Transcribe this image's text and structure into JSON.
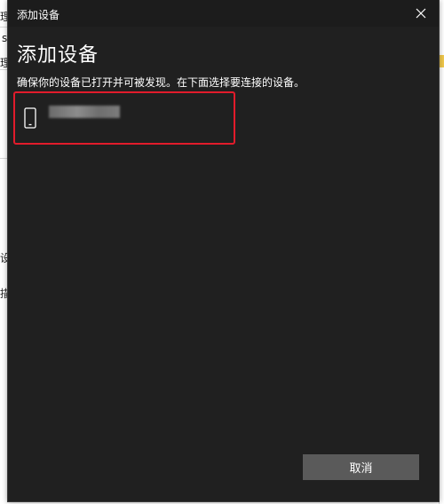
{
  "titlebar": {
    "title": "添加设备",
    "close_icon": "close-icon"
  },
  "main": {
    "heading": "添加设备",
    "instruction": "确保你的设备已打开并可被发现。在下面选择要连接的设备。",
    "devices": [
      {
        "icon": "phone-icon",
        "name": "████████"
      }
    ]
  },
  "footer": {
    "cancel_label": "取消"
  },
  "background": {
    "fragments": [
      "理",
      "s",
      "理",
      "设",
      "描"
    ]
  },
  "colors": {
    "dialog_bg": "#202020",
    "titlebar_bg": "#1c1c1c",
    "highlight_border": "#e21b2b",
    "button_bg": "#5a5a5a",
    "text": "#ffffff"
  }
}
